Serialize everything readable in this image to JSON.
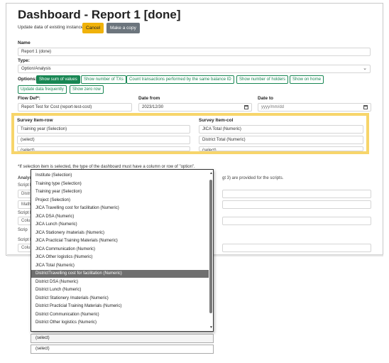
{
  "page": {
    "title": "Dashboard - Report 1 [done]",
    "subtitle": "Update data of existing instance.",
    "cancel_label": "Cancel",
    "copy_label": "Make a copy"
  },
  "form": {
    "name_label": "Name",
    "name_value": "Report 1 (done)",
    "type_label": "Type:",
    "type_value": "Option/Analysis",
    "options_label": "Options:",
    "options": [
      {
        "label": "Show sum of values",
        "active": true
      },
      {
        "label": "Show number of TXs",
        "active": false
      },
      {
        "label": "Count transactions performed by the same balance ID",
        "active": false
      },
      {
        "label": "Show number of holders",
        "active": false
      },
      {
        "label": "Show on home",
        "active": false
      },
      {
        "label": "Update data frequently",
        "active": false
      },
      {
        "label": "Show zero row",
        "active": false
      }
    ],
    "flow_def_label": "Flow Def*:",
    "flow_def_value": "Report Test for Cost (report-test-cost)",
    "date_from_label": "Date from",
    "date_from_value": "2023/12/30",
    "date_to_label": "Date to",
    "date_to_placeholder": "yyyy/mm/dd"
  },
  "survey": {
    "row_label": "Survey Item-row",
    "row_values": [
      "Training year (Selection)",
      "(select)",
      "(select)"
    ],
    "col_label": "Survey Item-col",
    "col_values": [
      "JICA Total (Numeric)",
      "District Total (Numeric)",
      "(select)"
    ]
  },
  "note": "*If selection item is selected, the type of the dashboard must have a column or row of \"option\".",
  "background": {
    "analysis_label": "Analys",
    "script_label": "Script I",
    "distr": "Distr",
    "math": "Math",
    "colu": "Colu",
    "scrip": "Scrip",
    "hidden_text": "gt 3) are provided for the scripts."
  },
  "dropdown": {
    "items": [
      "Institute (Selection)",
      "Training type (Selection)",
      "Training year (Selection)",
      "Project (Selection)",
      "JICA Travelling cost for facilitation (Numeric)",
      "JICA DSA (Numeric)",
      "JICA Lunch (Numeric)",
      "JICA Stationery /materials (Numeric)",
      "JICA Practicial Training Materials (Numeric)",
      "JICA Communication (Numeric)",
      "JICA Other logistics (Numeric)",
      "JICA Total (Numeric)",
      "DistrictTravelling cost for facilitation (Numeric)",
      "District DSA (Numeric)",
      "District Lunch (Numeric)",
      "District Stationery /materials (Numeric)",
      "District Practicial Training Materials (Numeric)",
      "District Communication (Numeric)",
      "District Other logistics (Numeric)"
    ],
    "selected_index": 12
  },
  "bottom_fields": [
    "(select)",
    "(select)"
  ]
}
